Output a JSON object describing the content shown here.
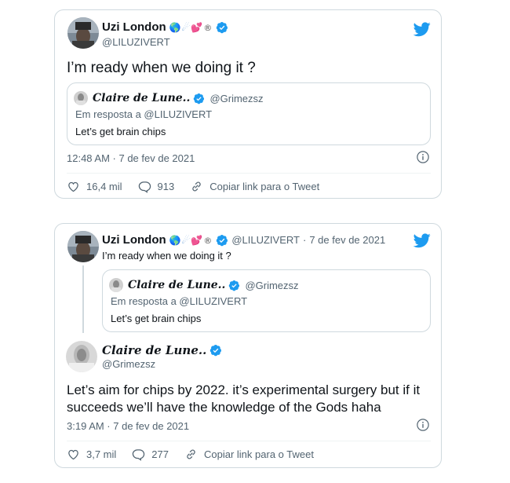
{
  "tweet1": {
    "author_name": "Uzi London",
    "author_emoji": {
      "globe": "🌎",
      "comet": "☄",
      "hearts": "💕",
      "reg": "®"
    },
    "author_handle": "@LILUZIVERT",
    "text": "I’m ready when we doing it ?",
    "quote": {
      "name": "Claire de Lune..",
      "handle": "@Grimezsz",
      "reply_to": "Em resposta a @LILUZIVERT",
      "text": "Let’s get brain chips"
    },
    "timestamp": "12:48 AM · 7 de fev de 2021",
    "likes": "16,4 mil",
    "replies": "913",
    "copy_link": "Copiar link para o Tweet"
  },
  "tweet2": {
    "parent": {
      "author_name": "Uzi London",
      "author_handle": "@LILUZIVERT",
      "date": "7 de fev de 2021",
      "text": "I’m ready when we doing it ?",
      "quote": {
        "name": "Claire de Lune..",
        "handle": "@Grimezsz",
        "reply_to": "Em resposta a @LILUZIVERT",
        "text": "Let’s get brain chips"
      }
    },
    "author_name": "Claire de Lune..",
    "author_handle": "@Grimezsz",
    "text_line1": "Let’s aim for chips by 2022.  it’s experimental surgery but if it",
    "text_line2": "succeeds we’ll have the knowledge of the Gods haha",
    "timestamp": "3:19 AM · 7 de fev de 2021",
    "likes": "3,7 mil",
    "replies": "277",
    "copy_link": "Copiar link para o Tweet"
  },
  "colors": {
    "twitter_blue": "#1d9bf0",
    "secondary_text": "#536471",
    "border": "#cfd9de"
  },
  "icons": [
    "twitter-bird-icon",
    "verified-badge-icon",
    "info-icon",
    "heart-icon",
    "reply-bubble-icon",
    "link-icon"
  ]
}
